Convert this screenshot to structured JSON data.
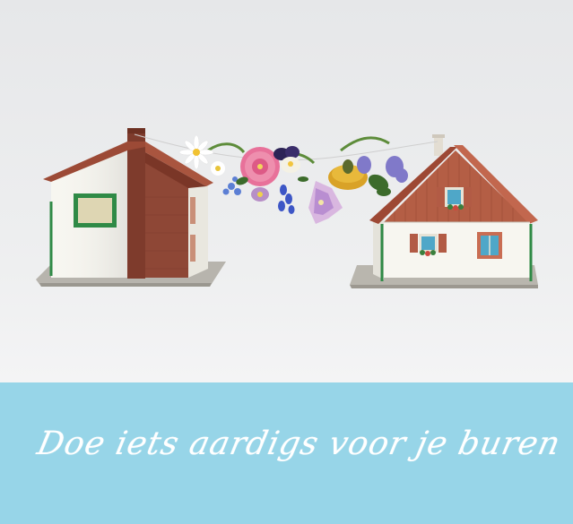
{
  "caption": {
    "text": "Doe iets aardigs voor je buren"
  },
  "colors": {
    "background_top": "#e7e8ea",
    "background_bottom": "#f3f3f4",
    "banner": "#97d5e8",
    "caption_text": "#ffffff",
    "roof": "#a9553f",
    "brick": "#8b4433",
    "wall": "#f5f4ee",
    "window_frame_green": "#2e8a45"
  },
  "scene": {
    "subjects": [
      "house-left",
      "house-right",
      "flower-garland"
    ]
  }
}
